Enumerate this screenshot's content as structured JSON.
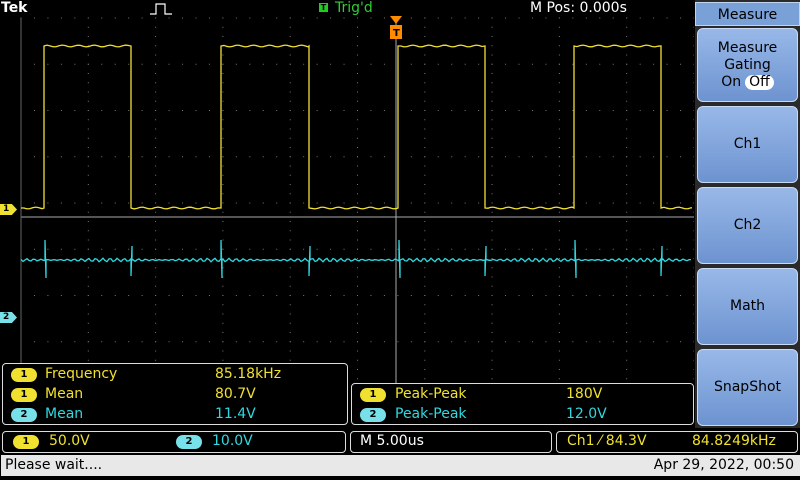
{
  "header": {
    "brand": "Tek",
    "trigger_state": "Trig'd",
    "trigger_badge": "T",
    "position_label": "M Pos: 0.000s"
  },
  "side_menu": {
    "title": "Measure",
    "gating": {
      "label_line1": "Measure",
      "label_line2": "Gating",
      "on": "On",
      "off": "Off"
    },
    "buttons": [
      "Ch1",
      "Ch2",
      "Math",
      "SnapShot"
    ]
  },
  "channel_markers": {
    "ch1": "1",
    "ch2": "2"
  },
  "measurements_left": [
    {
      "ch": "1",
      "name": "Frequency",
      "value": "85.18kHz"
    },
    {
      "ch": "1",
      "name": "Mean",
      "value": "80.7V"
    },
    {
      "ch": "2",
      "name": "Mean",
      "value": "11.4V"
    }
  ],
  "measurements_right": [
    {
      "ch": "1",
      "name": "Peak-Peak",
      "value": "180V"
    },
    {
      "ch": "2",
      "name": "Peak-Peak",
      "value": "12.0V"
    }
  ],
  "settings": {
    "ch1_num": "1",
    "ch1_scale": "50.0V",
    "ch2_num": "2",
    "ch2_scale": "10.0V",
    "timebase": "M 5.00us",
    "trigger_info": "Ch1 ⁄ 84.3V",
    "trigger_freq": "84.8249kHz"
  },
  "status": {
    "message": "Please wait....",
    "datetime": "Apr 29, 2022, 00:50"
  },
  "colors": {
    "ch1": "#f0e030",
    "ch2": "#30d8e0",
    "trigger": "#ff8c00",
    "accent_menu": "#7aa0d8"
  },
  "icons": {
    "trigger_arrow": "trigger-position-icon",
    "pulse": "pulse-icon"
  }
}
